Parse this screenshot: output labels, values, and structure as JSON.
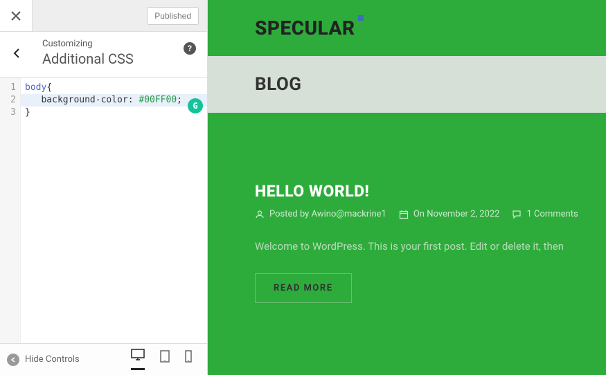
{
  "topBar": {
    "publishedLabel": "Published"
  },
  "panel": {
    "customizingLabel": "Customizing",
    "title": "Additional CSS"
  },
  "code": {
    "lineNumbers": [
      "1",
      "2",
      "3"
    ],
    "line1_tag": "body",
    "line1_brace": "{",
    "line2_indent": "   ",
    "line2_prop": "background-color",
    "line2_colon": ": ",
    "line2_value": "#00FF00",
    "line2_semi": ";",
    "line3_brace": "}"
  },
  "bottomBar": {
    "hideControls": "Hide Controls"
  },
  "site": {
    "title": "SPECULAR",
    "navLabel": "BLOG"
  },
  "post": {
    "title": "HELLO WORLD!",
    "postedByLabel": "Posted by ",
    "author": "Awino@mackrine1",
    "onLabel": "On ",
    "date": "November 2, 2022",
    "commentsLabel": "1 Comments",
    "excerpt": "Welcome to WordPress. This is your first post. Edit or delete it, then",
    "readMore": "READ MORE"
  }
}
